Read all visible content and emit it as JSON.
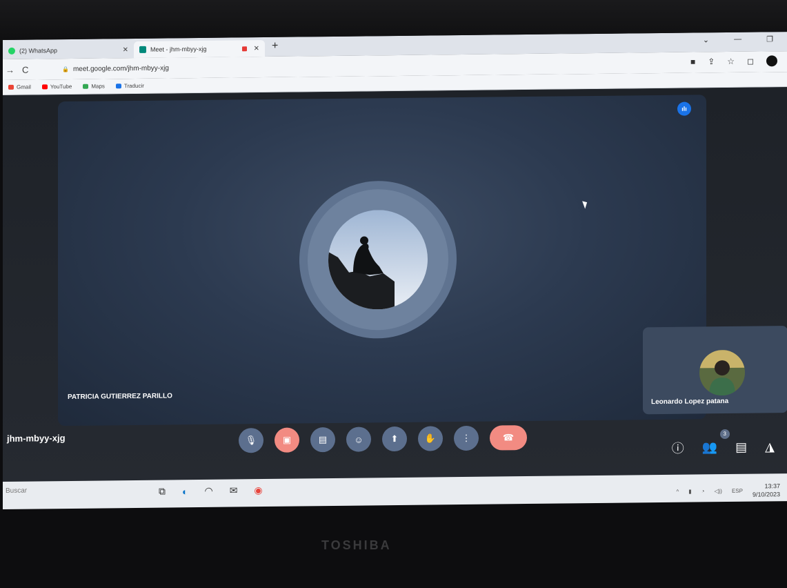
{
  "browser": {
    "tabs": [
      {
        "label": "(2) WhatsApp",
        "favicon": "whatsapp-icon",
        "color": "#25d366",
        "active": false
      },
      {
        "label": "Meet - jhm-mbyy-xjg",
        "favicon": "meet-icon",
        "color": "#00897b",
        "active": true
      }
    ],
    "url": "meet.google.com/jhm-mbyy-xjg",
    "bookmarks": [
      {
        "label": "Gmail",
        "color": "#ea4335"
      },
      {
        "label": "YouTube",
        "color": "#ff0000"
      },
      {
        "label": "Maps",
        "color": "#34a853"
      },
      {
        "label": "Traducir",
        "color": "#1a73e8"
      }
    ]
  },
  "meet": {
    "main_participant": "PATRICIA GUTIERREZ PARILLO",
    "tile_participant": "Leonardo Lopez patana",
    "meeting_code": "jhm-mbyy-xjg",
    "participant_count": "3",
    "accent": "#1a73e8",
    "danger": "#f28b82"
  },
  "taskbar": {
    "search_placeholder": "Buscar",
    "language": "ESP",
    "time": "13:37",
    "date": "9/10/2023"
  },
  "laptop": {
    "brand": "TOSHIBA"
  }
}
